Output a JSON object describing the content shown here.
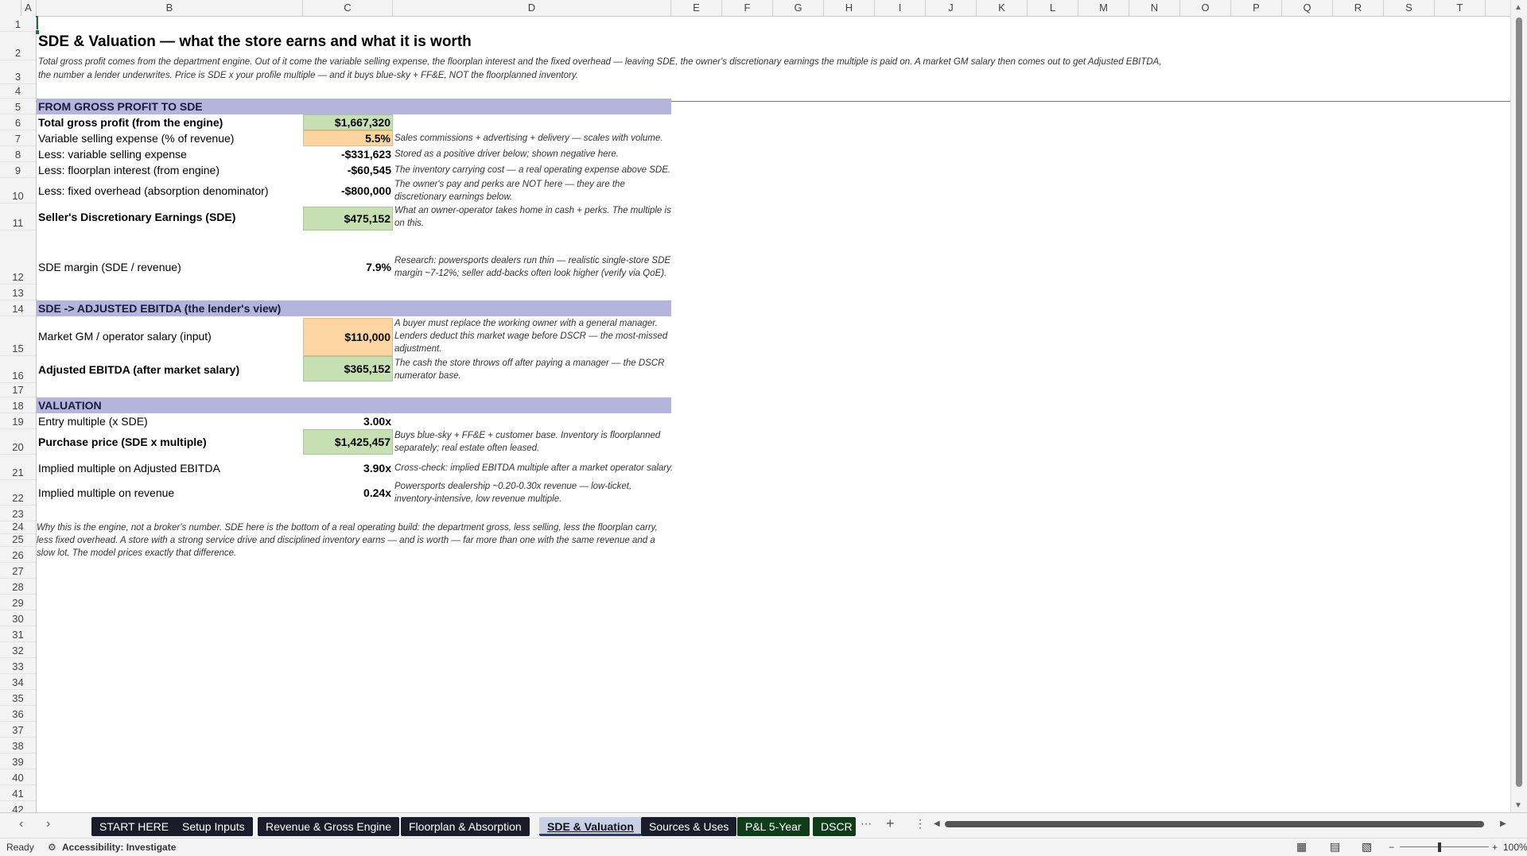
{
  "columns": [
    "A",
    "B",
    "C",
    "D",
    "E",
    "F",
    "G",
    "H",
    "I",
    "J",
    "K",
    "L",
    "M",
    "N",
    "O",
    "P",
    "Q",
    "R",
    "S",
    "T"
  ],
  "rows": [
    "1",
    "2",
    "3",
    "4",
    "5",
    "6",
    "7",
    "8",
    "9",
    "10",
    "11",
    "12",
    "13",
    "14",
    "15",
    "16",
    "17",
    "18",
    "19",
    "20",
    "21",
    "22",
    "23",
    "24",
    "25",
    "26",
    "27",
    "28",
    "29",
    "30",
    "31",
    "32",
    "33",
    "34",
    "35",
    "36",
    "37",
    "38",
    "39",
    "40",
    "41",
    "42"
  ],
  "sheet": {
    "title": "SDE & Valuation — what the store earns and what it is worth",
    "subtitle": "Total gross profit comes from the department engine. Out of it come the variable selling expense, the floorplan interest and the fixed overhead — leaving SDE, the owner's discretionary earnings the multiple is paid on. A market GM salary then comes out to get Adjusted EBITDA, the number a lender underwrites. Price is SDE x your profile multiple — and it buys blue-sky + FF&E, NOT the floorplanned inventory.",
    "section1": "FROM GROSS PROFIT TO SDE",
    "r6_label": "Total gross profit (from the engine)",
    "r6_value": "$1,667,320",
    "r7_label": "Variable selling expense (% of revenue)",
    "r7_value": "5.5%",
    "r7_note": "Sales commissions + advertising + delivery — scales with volume.",
    "r8_label": "Less: variable selling expense",
    "r8_value": "-$331,623",
    "r8_note": "Stored as a positive driver below; shown negative here.",
    "r9_label": "Less: floorplan interest (from engine)",
    "r9_value": "-$60,545",
    "r9_note": "The inventory carrying cost — a real operating expense above SDE.",
    "r10_label": "Less: fixed overhead (absorption denominator)",
    "r10_value": "-$800,000",
    "r10_note": "The owner's pay and perks are NOT here — they are the discretionary earnings below.",
    "r11_label": "Seller's Discretionary Earnings (SDE)",
    "r11_value": "$475,152",
    "r11_note": "What an owner-operator takes home in cash + perks. The multiple is on this.",
    "r12_label": "SDE margin (SDE / revenue)",
    "r12_value": "7.9%",
    "r12_note": "Research: powersports dealers run thin — realistic single-store SDE margin ~7-12%; seller add-backs often look higher (verify via QoE).",
    "section2": "SDE -> ADJUSTED EBITDA  (the lender's view)",
    "r15_label": "Market GM / operator salary (input)",
    "r15_value": "$110,000",
    "r15_note": "A buyer must replace the working owner with a general manager. Lenders deduct this market wage before DSCR — the most-missed adjustment.",
    "r16_label": "Adjusted EBITDA (after market salary)",
    "r16_value": "$365,152",
    "r16_note": "The cash the store throws off after paying a manager — the DSCR numerator base.",
    "section3": "VALUATION",
    "r19_label": "Entry multiple (x SDE)",
    "r19_value": "3.00x",
    "r20_label": "Purchase price (SDE x multiple)",
    "r20_value": "$1,425,457",
    "r20_note": "Buys blue-sky + FF&E + customer base. Inventory is floorplanned separately; real estate often leased.",
    "r21_label": "Implied multiple on Adjusted EBITDA",
    "r21_value": "3.90x",
    "r21_note": "Cross-check: implied EBITDA multiple after a market operator salary.",
    "r22_label": "Implied multiple on revenue",
    "r22_value": "0.24x",
    "r22_note": "Powersports dealership ~0.20-0.30x revenue — low-ticket, inventory-intensive, low revenue multiple.",
    "footnote": "Why this is the engine, not a broker's number. SDE here is the bottom of a real operating build: the department gross, less selling, less the floorplan carry, less fixed overhead. A store with a strong service drive and disciplined inventory earns — and is worth — far more than one with the same revenue and a slow lot. The model prices exactly that difference."
  },
  "tabs": {
    "t1": "START HERE",
    "t2": "Setup Inputs",
    "t3": "Revenue & Gross Engine",
    "t4": "Floorplan & Absorption",
    "t5": "SDE & Valuation",
    "t6": "Sources & Uses",
    "t7": "P&L 5-Year",
    "t8": "DSCR &"
  },
  "status": {
    "ready": "Ready",
    "accessibility": "Accessibility: Investigate",
    "zoom": "100%"
  }
}
